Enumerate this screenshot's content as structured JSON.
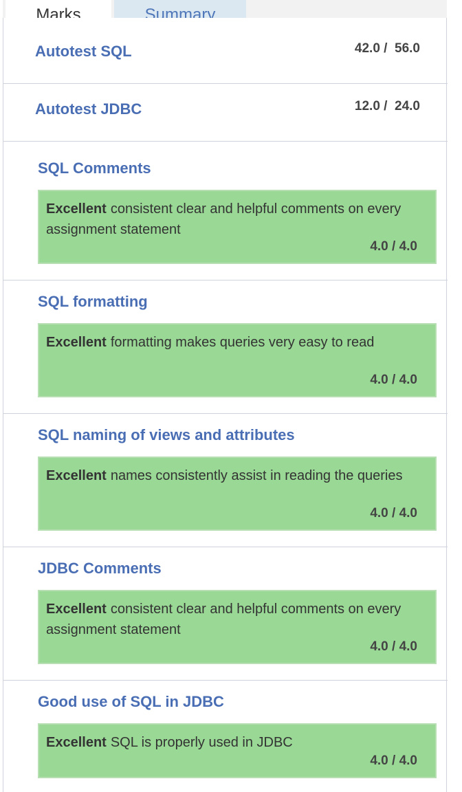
{
  "tabs": [
    {
      "label": "Marks"
    },
    {
      "label": "Summary"
    }
  ],
  "autotests": [
    {
      "title": "Autotest SQL",
      "score": "42.0 /  56.0"
    },
    {
      "title": "Autotest JDBC",
      "score": "12.0 /  24.0"
    }
  ],
  "criteria": [
    {
      "title": "SQL Comments",
      "level": "Excellent",
      "description": "consistent clear and helpful comments on every assignment statement",
      "score": "4.0 / 4.0"
    },
    {
      "title": "SQL formatting",
      "level": "Excellent",
      "description": "formatting makes queries very easy to read",
      "score": "4.0 / 4.0"
    },
    {
      "title": "SQL naming of views and attributes",
      "level": "Excellent",
      "description": "names consistently assist in reading the queries",
      "score": "4.0 / 4.0"
    },
    {
      "title": "JDBC Comments",
      "level": "Excellent",
      "description": "consistent clear and helpful comments on every assignment statement",
      "score": "4.0 / 4.0"
    },
    {
      "title": "Good use of SQL in JDBC",
      "level": "Excellent",
      "description": "SQL is properly used in JDBC",
      "score": "4.0 / 4.0"
    }
  ],
  "colors": {
    "title_blue": "#4a6eb4",
    "rubric_green": "#9ad895",
    "tab_active_bg": "#ffffff",
    "tab_inactive_bg": "#dbe8f2"
  }
}
